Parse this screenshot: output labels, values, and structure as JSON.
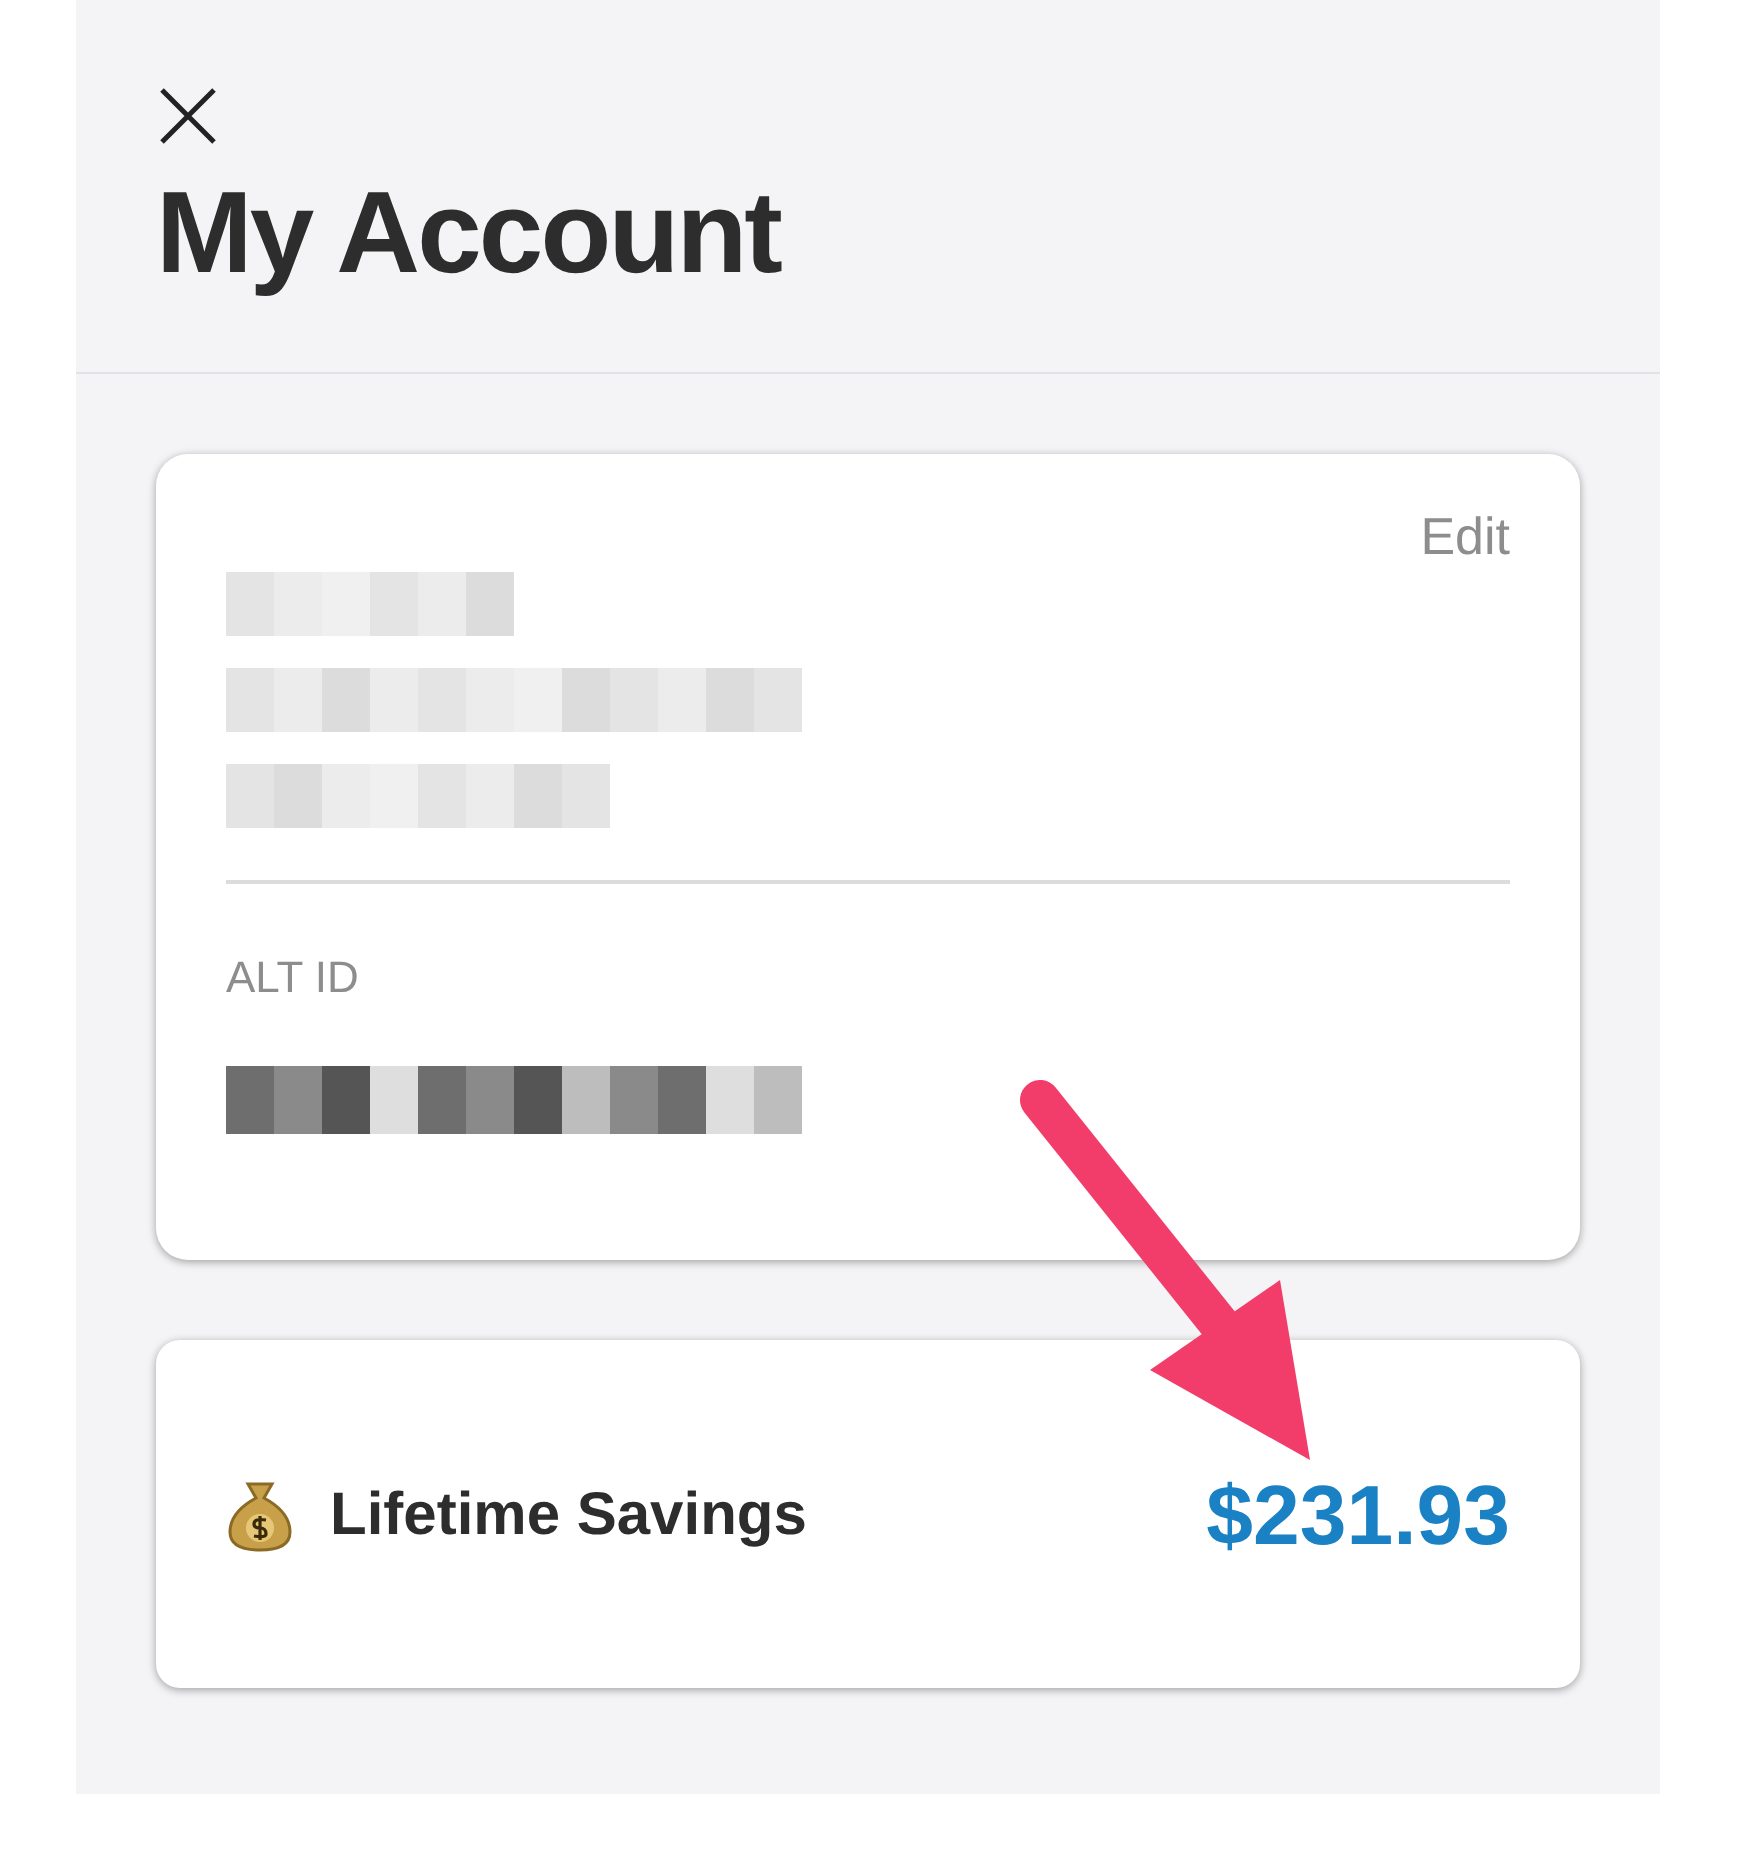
{
  "header": {
    "title": "My Account"
  },
  "profile_card": {
    "edit_label": "Edit",
    "alt_id_label": "ALT ID"
  },
  "savings_card": {
    "label": "Lifetime Savings",
    "amount": "$231.93"
  }
}
